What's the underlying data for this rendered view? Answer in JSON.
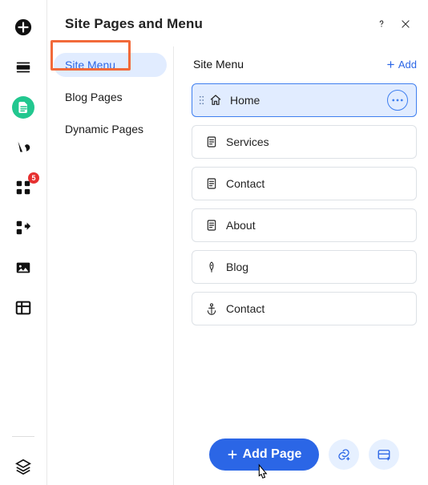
{
  "header": {
    "title": "Site Pages and Menu"
  },
  "subnav": {
    "items": [
      {
        "label": "Site Menu",
        "active": true
      },
      {
        "label": "Blog Pages",
        "active": false
      },
      {
        "label": "Dynamic Pages",
        "active": false
      }
    ]
  },
  "content": {
    "title": "Site Menu",
    "add_label": "Add"
  },
  "pages": [
    {
      "label": "Home",
      "icon": "home",
      "selected": true
    },
    {
      "label": "Services",
      "icon": "page",
      "selected": false
    },
    {
      "label": "Contact",
      "icon": "page",
      "selected": false
    },
    {
      "label": "About",
      "icon": "page",
      "selected": false
    },
    {
      "label": "Blog",
      "icon": "pen",
      "selected": false
    },
    {
      "label": "Contact",
      "icon": "anchor",
      "selected": false
    }
  ],
  "footer": {
    "add_page_label": "Add Page"
  },
  "rail": {
    "badge_apps": "5"
  }
}
